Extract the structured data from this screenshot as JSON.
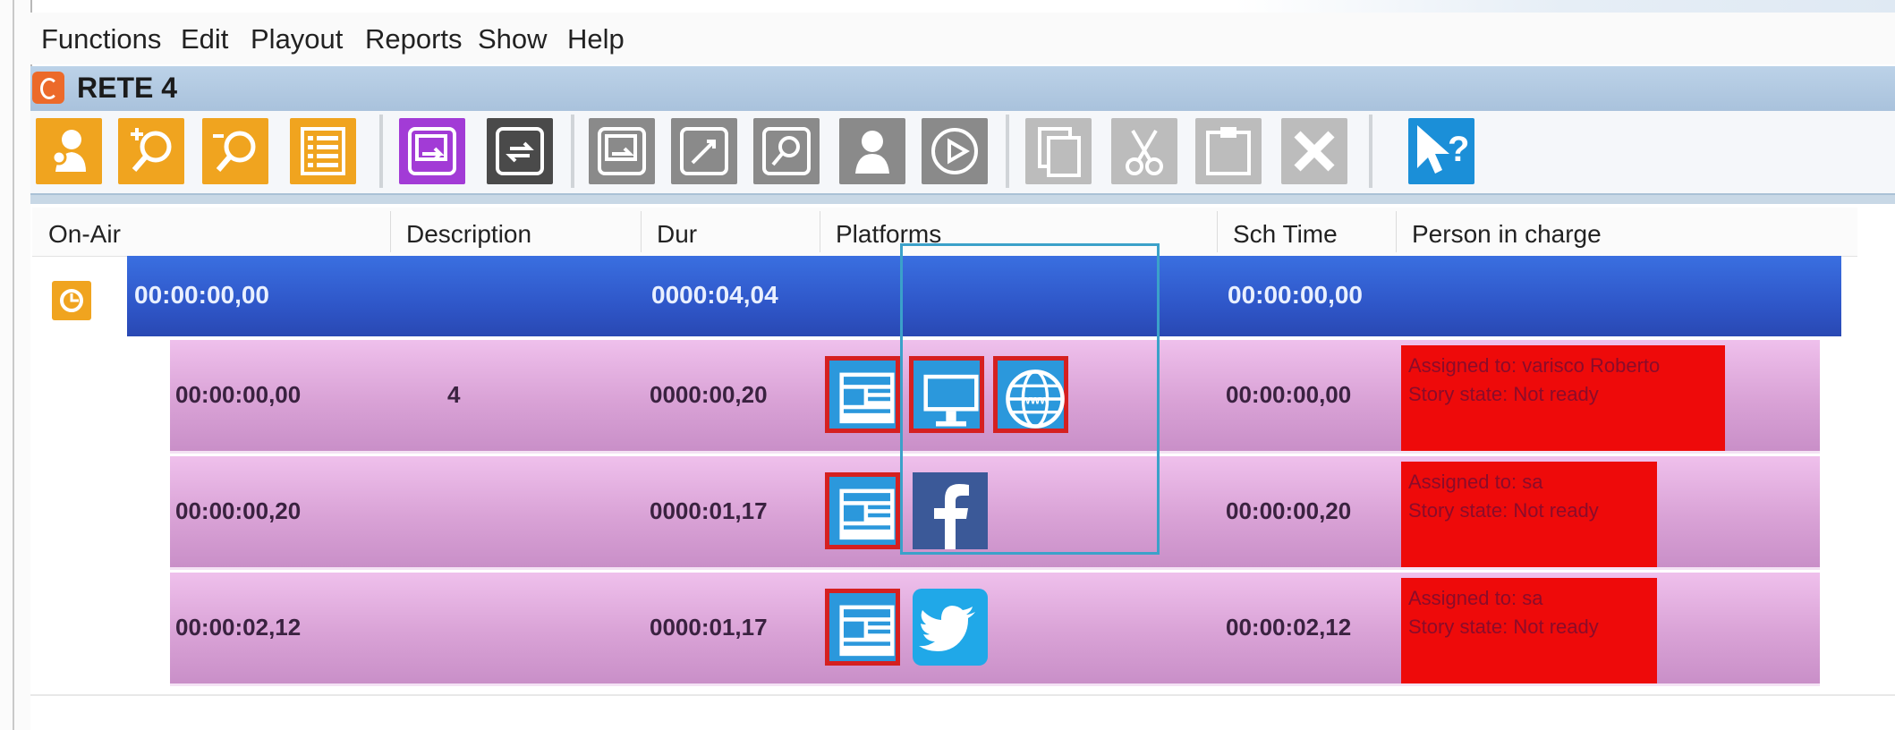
{
  "menu": {
    "items": [
      "Functions",
      "Edit",
      "Playout",
      "Reports",
      "Show",
      "Help"
    ]
  },
  "window": {
    "title": "RETE 4"
  },
  "toolbar": {
    "buttons": [
      {
        "name": "user-pin-icon",
        "color": "#f0a41f"
      },
      {
        "name": "add-search-icon",
        "color": "#f0a41f"
      },
      {
        "name": "search-icon",
        "color": "#f0a41f"
      },
      {
        "name": "list-icon",
        "color": "#f0a41f"
      },
      {
        "name": "purple-transfer-icon",
        "color": "#a23bd6"
      },
      {
        "name": "refresh-box-icon",
        "color": "#4a4a4a"
      },
      {
        "name": "transfer-icon",
        "color": "#8a8a8a"
      },
      {
        "name": "edit-link-icon",
        "color": "#8a8a8a"
      },
      {
        "name": "document-search-icon",
        "color": "#8a8a8a"
      },
      {
        "name": "person-icon",
        "color": "#8a8a8a"
      },
      {
        "name": "play-icon",
        "color": "#8a8a8a"
      },
      {
        "name": "copy-icon",
        "color": "#bcbcbc"
      },
      {
        "name": "cut-icon",
        "color": "#bcbcbc"
      },
      {
        "name": "paste-icon",
        "color": "#bcbcbc"
      },
      {
        "name": "delete-icon",
        "color": "#bcbcbc"
      },
      {
        "name": "help-pointer-icon",
        "color": "#1b8fd8"
      }
    ]
  },
  "columns": {
    "on_air": "On-Air",
    "description": "Description",
    "dur": "Dur",
    "platforms": "Platforms",
    "sch_time": "Sch Time",
    "person": "Person in charge"
  },
  "group": {
    "on_air": "00:00:00,00",
    "dur": "0000:04,04",
    "sch_time": "00:00:00,00",
    "color": "#2f57c9"
  },
  "rows": [
    {
      "on_air": "00:00:00,00",
      "description": "4",
      "dur": "0000:00,20",
      "sch_time": "00:00:00,00",
      "platforms": [
        "web-page-icon",
        "monitor-icon",
        "www-globe-icon"
      ],
      "person": {
        "assigned": "Assigned to: varisco Roberto",
        "state": "Story state: Not ready"
      }
    },
    {
      "on_air": "00:00:00,20",
      "description": "",
      "dur": "0000:01,17",
      "sch_time": "00:00:00,20",
      "platforms": [
        "web-page-icon",
        "facebook-icon"
      ],
      "person": {
        "assigned": "Assigned to: sa",
        "state": "Story state: Not ready"
      }
    },
    {
      "on_air": "00:00:02,12",
      "description": "",
      "dur": "0000:01,17",
      "sch_time": "00:00:02,12",
      "platforms": [
        "web-page-icon",
        "twitter-icon"
      ],
      "person": {
        "assigned": "Assigned to: sa",
        "state": "Story state: Not ready"
      }
    }
  ]
}
